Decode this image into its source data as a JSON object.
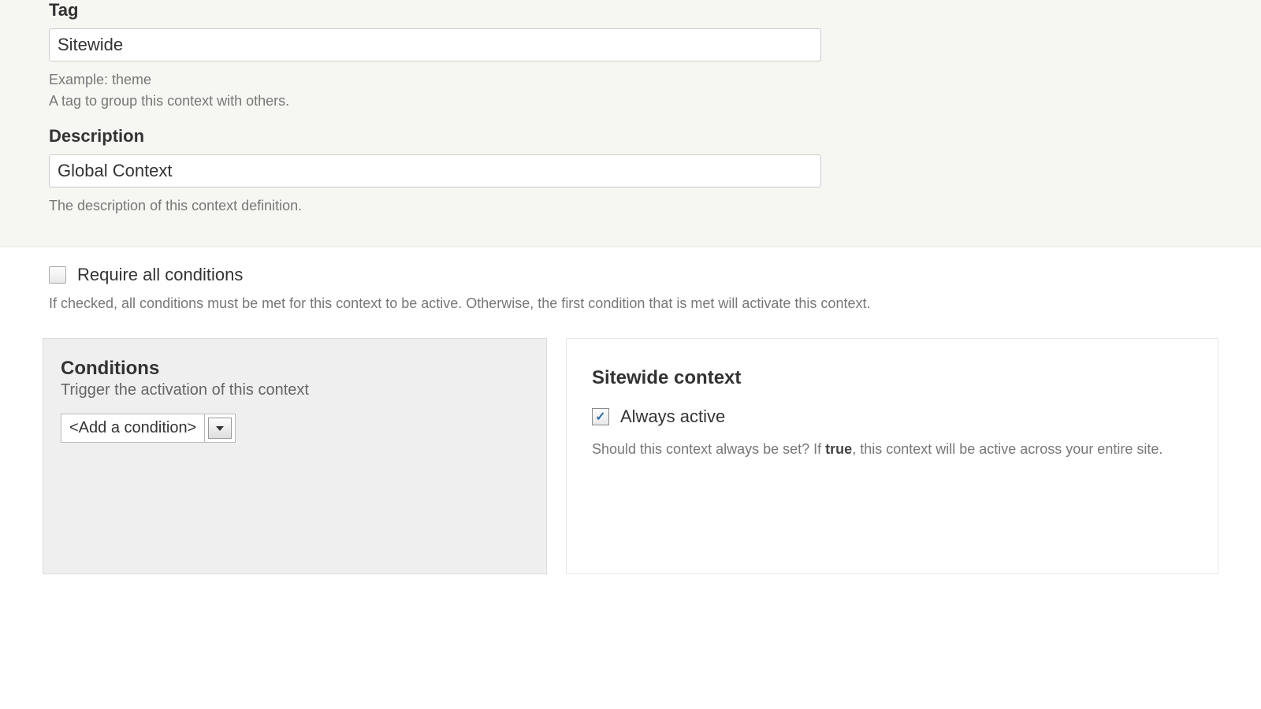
{
  "tag": {
    "label": "Tag",
    "value": "Sitewide",
    "help_line1": "Example: theme",
    "help_line2": "A tag to group this context with others."
  },
  "description": {
    "label": "Description",
    "value": "Global Context",
    "help": "The description of this context definition."
  },
  "require_all": {
    "label": "Require all conditions",
    "help": "If checked, all conditions must be met for this context to be active. Otherwise, the first condition that is met will activate this context."
  },
  "conditions_panel": {
    "title": "Conditions",
    "subtitle": "Trigger the activation of this context",
    "select_placeholder": "<Add a condition>"
  },
  "sitewide_panel": {
    "title": "Sitewide context",
    "checkbox_label": "Always active",
    "help_prefix": "Should this context always be set? If ",
    "help_bold": "true",
    "help_suffix": ", this context will be active across your entire site."
  }
}
